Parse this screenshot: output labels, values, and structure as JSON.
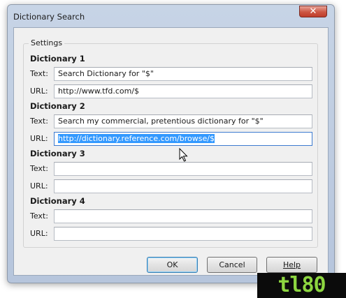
{
  "window": {
    "title": "Dictionary Search",
    "close_label": "✕"
  },
  "settings": {
    "legend": "Settings",
    "text_label": "Text:",
    "url_label": "URL:",
    "dictionaries": [
      {
        "heading": "Dictionary 1",
        "text": "Search Dictionary for \"$\"",
        "url": "http://www.tfd.com/$"
      },
      {
        "heading": "Dictionary 2",
        "text": "Search my commercial, pretentious dictionary for \"$\"",
        "url": "http://dictionary.reference.com/browse/$"
      },
      {
        "heading": "Dictionary 3",
        "text": "",
        "url": ""
      },
      {
        "heading": "Dictionary 4",
        "text": "",
        "url": ""
      }
    ]
  },
  "buttons": {
    "ok": "OK",
    "cancel": "Cancel",
    "help": "Help"
  },
  "watermark": {
    "text": "tl80"
  }
}
